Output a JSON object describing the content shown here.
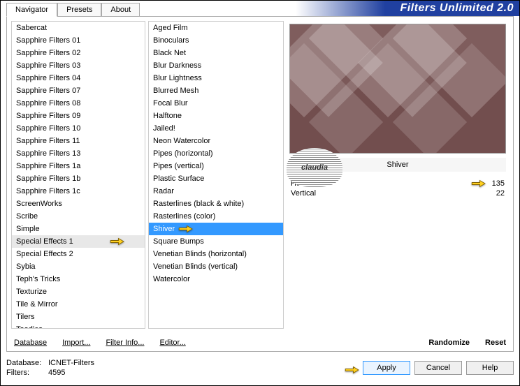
{
  "title": "Filters Unlimited 2.0",
  "tabs": [
    "Navigator",
    "Presets",
    "About"
  ],
  "active_tab": 0,
  "left_list": [
    "Sabercat",
    "Sapphire Filters 01",
    "Sapphire Filters 02",
    "Sapphire Filters 03",
    "Sapphire Filters 04",
    "Sapphire Filters 07",
    "Sapphire Filters 08",
    "Sapphire Filters 09",
    "Sapphire Filters 10",
    "Sapphire Filters 11",
    "Sapphire Filters 13",
    "Sapphire Filters 1a",
    "Sapphire Filters 1b",
    "Sapphire Filters 1c",
    "ScreenWorks",
    "Scribe",
    "Simple",
    "Special Effects 1",
    "Special Effects 2",
    "Sybia",
    "Teph's Tricks",
    "Texturize",
    "Tile & Mirror",
    "Tilers",
    "Toadies"
  ],
  "left_selected": 17,
  "mid_list": [
    "Aged Film",
    "Binoculars",
    "Black Net",
    "Blur Darkness",
    "Blur Lightness",
    "Blurred Mesh",
    "Focal Blur",
    "Halftone",
    "Jailed!",
    "Neon Watercolor",
    "Pipes (horizontal)",
    "Pipes (vertical)",
    "Plastic Surface",
    "Radar",
    "Rasterlines (black & white)",
    "Rasterlines (color)",
    "Shiver",
    "Square Bumps",
    "Venetian Blinds (horizontal)",
    "Venetian Blinds (vertical)",
    "Watercolor"
  ],
  "mid_selected": 16,
  "current_filter": "Shiver",
  "params": [
    {
      "label": "Horizontal",
      "value": 135
    },
    {
      "label": "Vertical",
      "value": 22
    }
  ],
  "bottom_links": {
    "database": "Database",
    "import": "Import...",
    "filter_info": "Filter Info...",
    "editor": "Editor...",
    "randomize": "Randomize",
    "reset": "Reset"
  },
  "footer": {
    "db_label": "Database:",
    "db_value": "ICNET-Filters",
    "filters_label": "Filters:",
    "filters_value": "4595"
  },
  "buttons": {
    "apply": "Apply",
    "cancel": "Cancel",
    "help": "Help"
  },
  "watermark": "claudia"
}
